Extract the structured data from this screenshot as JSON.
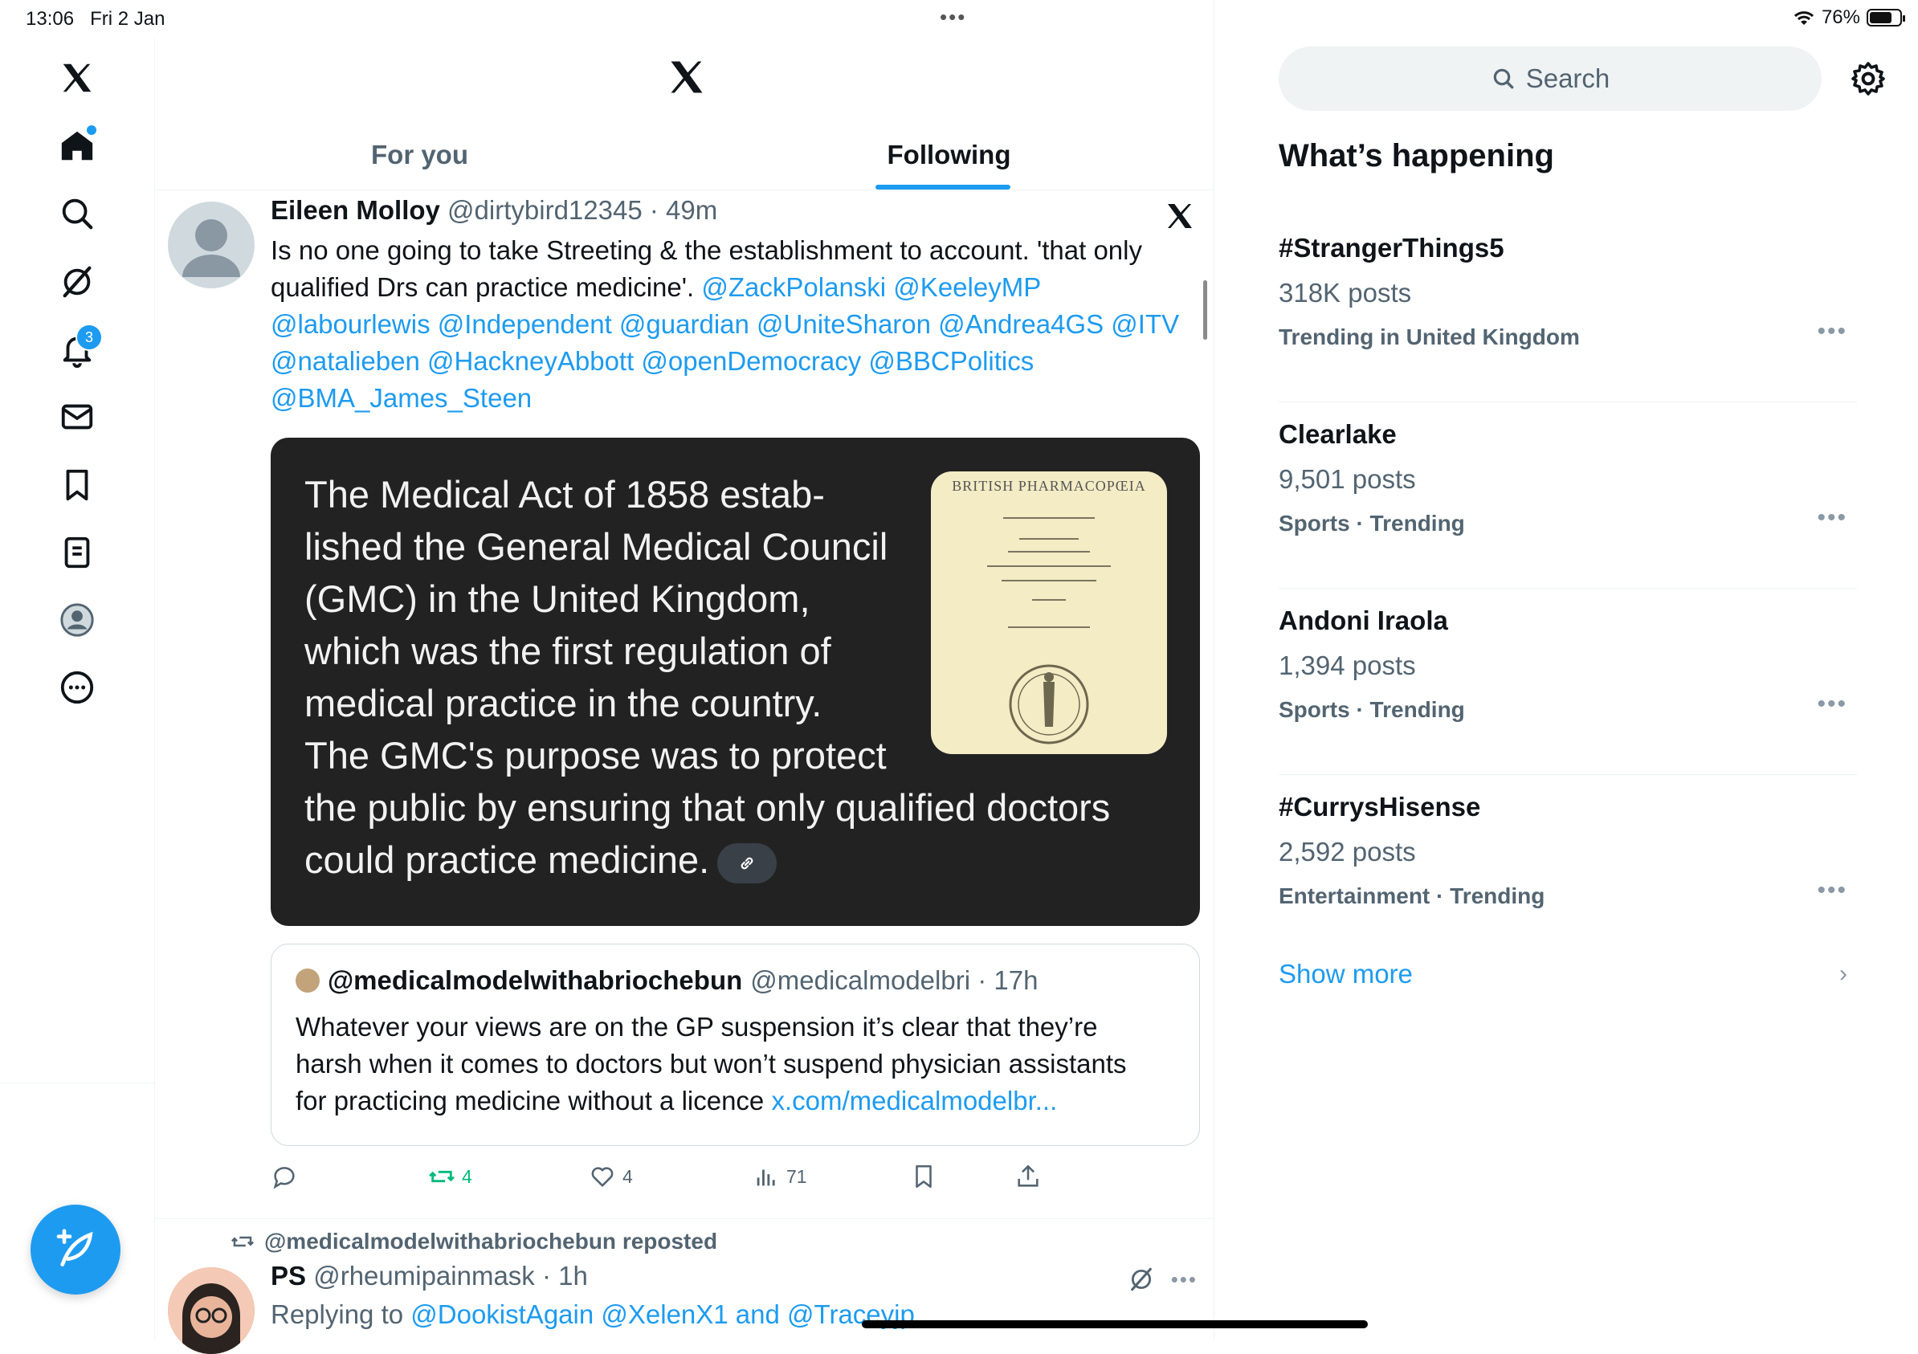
{
  "status": {
    "time": "13:06",
    "date": "Fri 2 Jan",
    "battery": "76%",
    "battery_level": 0.76
  },
  "nav": {
    "items": [
      "x-logo",
      "home",
      "search",
      "grok",
      "notifications",
      "messages",
      "bookmarks",
      "lists",
      "profile",
      "more"
    ],
    "notifications_badge": "3"
  },
  "tabs": {
    "for_you": "For you",
    "following": "Following"
  },
  "tweet": {
    "name": "Eileen Molloy",
    "handle": "@dirtybird12345",
    "sep": " · ",
    "time": "49m",
    "text_l1": "Is no one going to take Streeting & the establishment to account. 'that only",
    "text_l2_plain": "qualified Drs can practice medicine'. ",
    "mentions_l2": "@ZackPolanski @KeeleyMP",
    "mentions_l3": "@labourlewis @Independent @guardian @UniteSharon @Andrea4GS @ITV",
    "mentions_l4": "@natalieben @HackneyAbbott @openDemocracy @BBCPolitics",
    "mentions_l5": "@BMA_James_Steen",
    "card": {
      "lines": [
        "The Medical Act of 1858 estab-",
        "lished the General Medical Council",
        "(GMC) in the United Kingdom,",
        "which was the first regulation of",
        "medical practice in the country.",
        "The GMC's purpose was to protect",
        "the public by ensuring that only qualified doctors",
        "could practice medicine."
      ],
      "book_title": "BRITISH  PHARMACOPŒIA"
    },
    "quote": {
      "name": "@medicalmodelwithabriochebun",
      "handle": "@medicalmodelbri",
      "time": "17h",
      "text_l1": "Whatever your views are on the GP suspension it’s clear that they’re",
      "text_l2": "harsh when it comes to doctors  but won’t suspend physician assistants",
      "text_l3": "for practicing medicine without a licence ",
      "link": "x.com/medicalmodelbr..."
    },
    "actions": {
      "replies": "",
      "reposts": "4",
      "likes": "4",
      "views": "71"
    }
  },
  "next_tweet": {
    "repost_label": "@medicalmodelwithabriochebun reposted",
    "name": "PS",
    "handle": "@rheumipainmask",
    "time": "1h",
    "reply_prefix": "Replying to ",
    "reply_to": "@DookistAgain @XelenX1 and @Traceyjp"
  },
  "right": {
    "search_placeholder": "Search",
    "section_title": "What’s happening",
    "trends": [
      {
        "name": "#StrangerThings5",
        "posts": "318K posts",
        "meta": "Trending in United Kingdom"
      },
      {
        "name": "Clearlake",
        "posts": "9,501 posts",
        "meta": "Sports · Trending"
      },
      {
        "name": "Andoni Iraola",
        "posts": "1,394 posts",
        "meta": "Sports · Trending"
      },
      {
        "name": "#CurrysHisense",
        "posts": "2,592 posts",
        "meta": "Entertainment · Trending"
      }
    ],
    "show_more": "Show more"
  },
  "colors": {
    "accent": "#1d9bf0",
    "repost": "#00ba7c",
    "text": "#0f1419",
    "muted": "#536471"
  }
}
